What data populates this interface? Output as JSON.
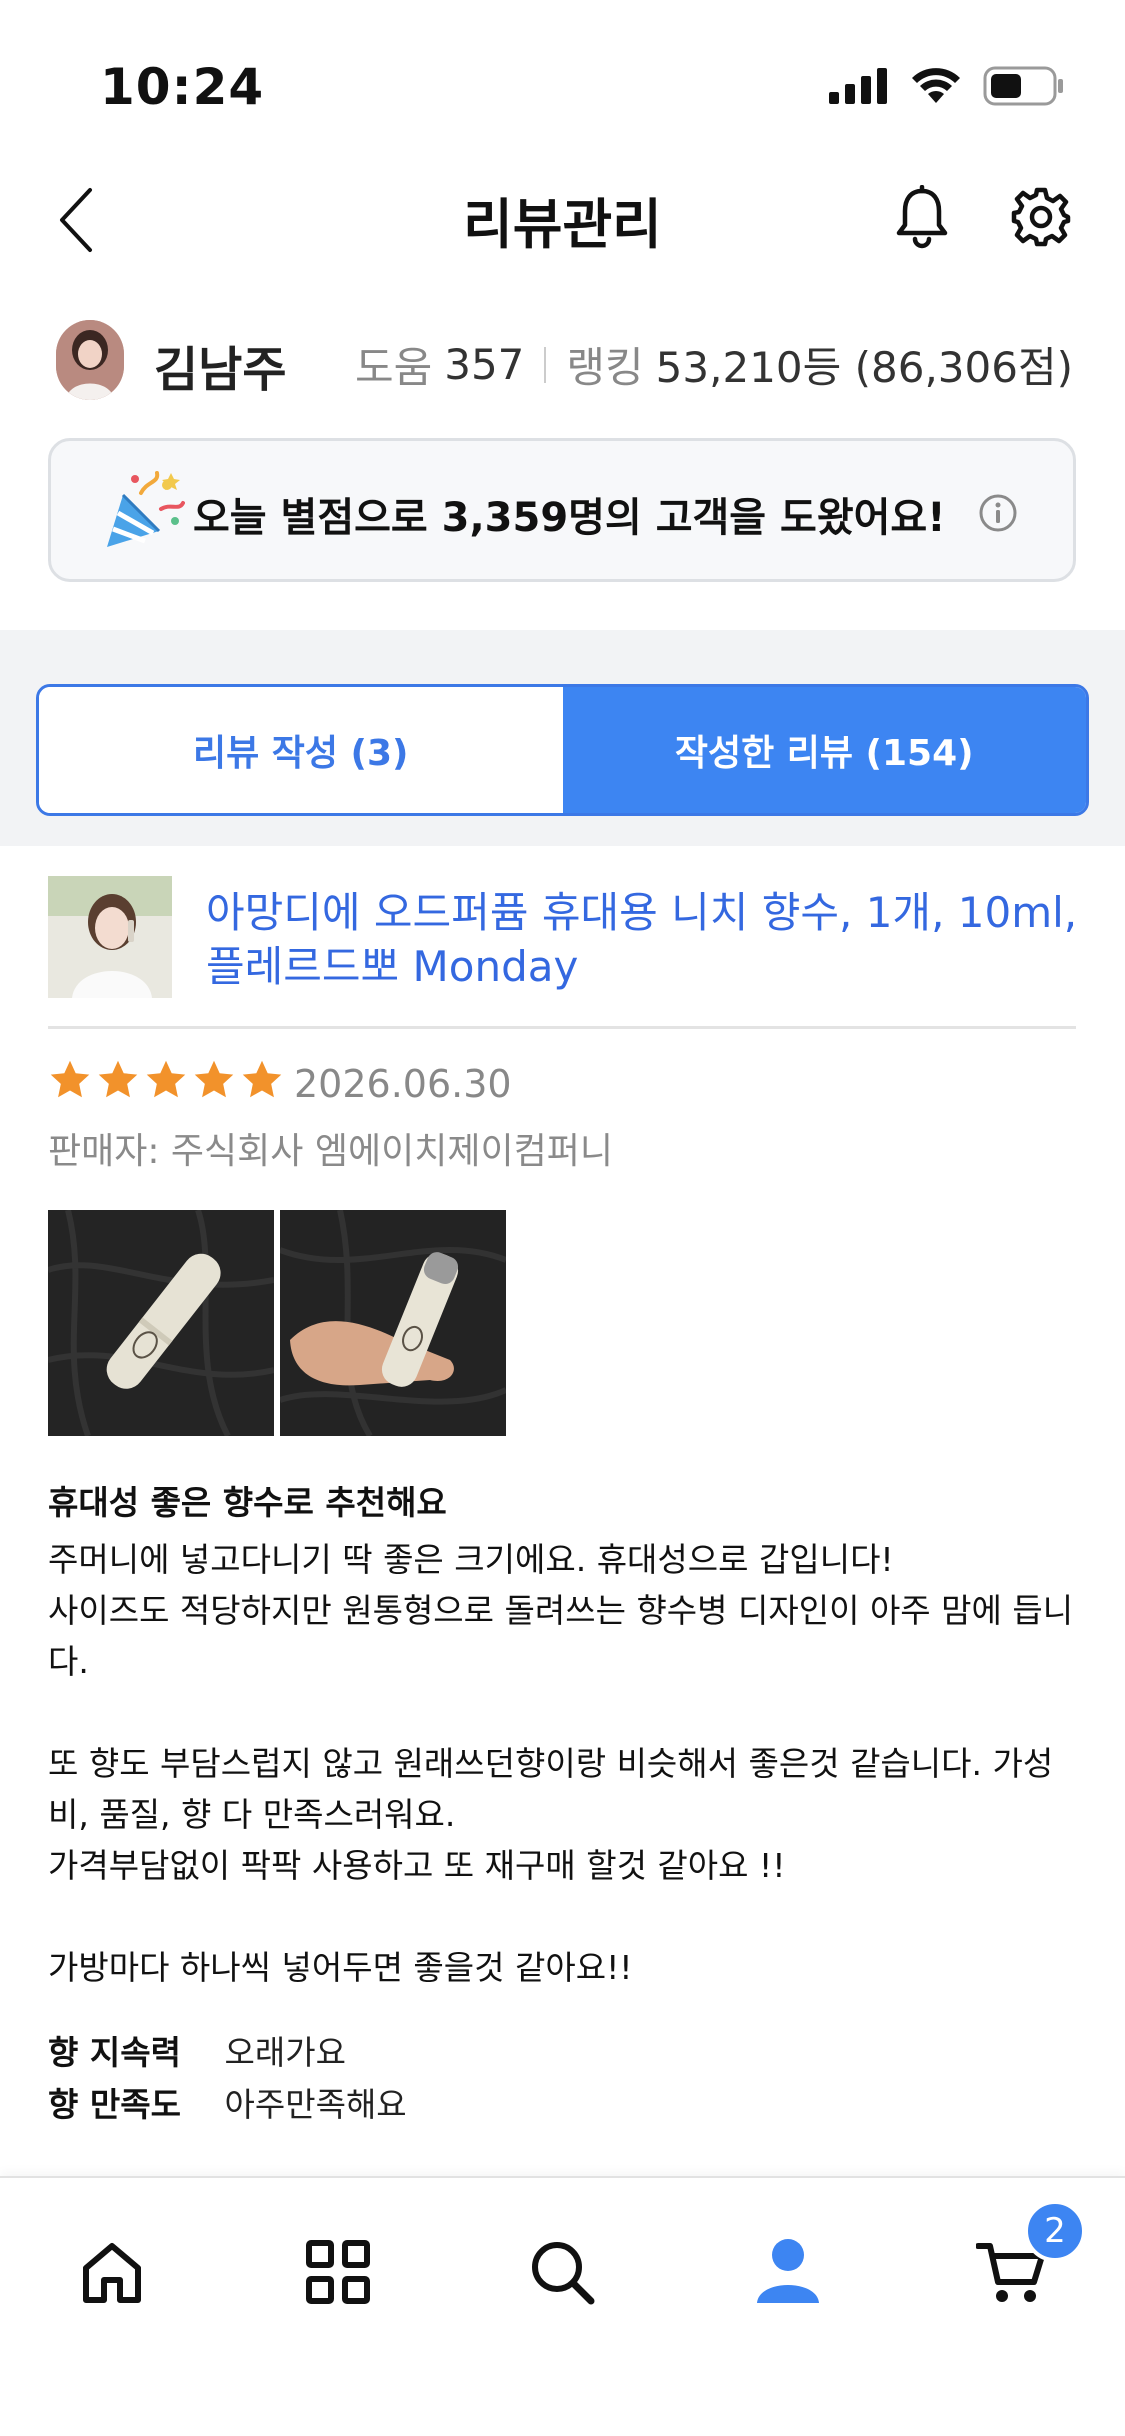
{
  "status_bar": {
    "time": "10:24"
  },
  "header": {
    "title": "리뷰관리"
  },
  "profile": {
    "name": "김남주",
    "help_label": "도움",
    "help_count": "357",
    "rank_label": "랭킹",
    "rank_value": "53,210등 (86,306점)"
  },
  "banner": {
    "text": "오늘 별점으로 3,359명의 고객을 도왔어요!"
  },
  "tabs": [
    {
      "label": "리뷰 작성 (3)",
      "active": false
    },
    {
      "label": "작성한 리뷰 (154)",
      "active": true
    }
  ],
  "review": {
    "product_name": "아망디에 오드퍼퓸 휴대용 니치 향수, 1개, 10ml, 플레르드뽀 Monday",
    "rating": 5,
    "rating_max": 5,
    "date": "2026.06.30",
    "seller": "판매자: 주식회사 엠에이치제이컴퍼니",
    "title": "휴대성 좋은 향수로 추천해요",
    "body": "주머니에 넣고다니기 딱 좋은 크기에요. 휴대성으로 갑입니다!\n사이즈도 적당하지만 원통형으로 돌려쓰는 향수병 디자인이 아주 맘에 듭니다.\n\n또 향도 부담스럽지 않고 원래쓰던향이랑 비슷해서 좋은것 같습니다. 가성비, 품질, 향 다 만족스러워요.\n가격부담없이 팍팍 사용하고 또 재구매 할것 같아요 !!\n\n가방마다 하나씩 넣어두면 좋을것 같아요!!",
    "attributes": [
      {
        "key": "향 지속력",
        "value": "오래가요"
      },
      {
        "key": "향 만족도",
        "value": "아주만족해요"
      }
    ]
  },
  "bottom_nav": {
    "items": [
      "home-icon",
      "category-icon",
      "search-icon",
      "my-page-icon",
      "cart-icon"
    ],
    "active": "my-page-icon",
    "cart_badge": "2"
  },
  "colors": {
    "accent": "#3d85f2",
    "link": "#3468e0",
    "star": "#f2922b"
  }
}
